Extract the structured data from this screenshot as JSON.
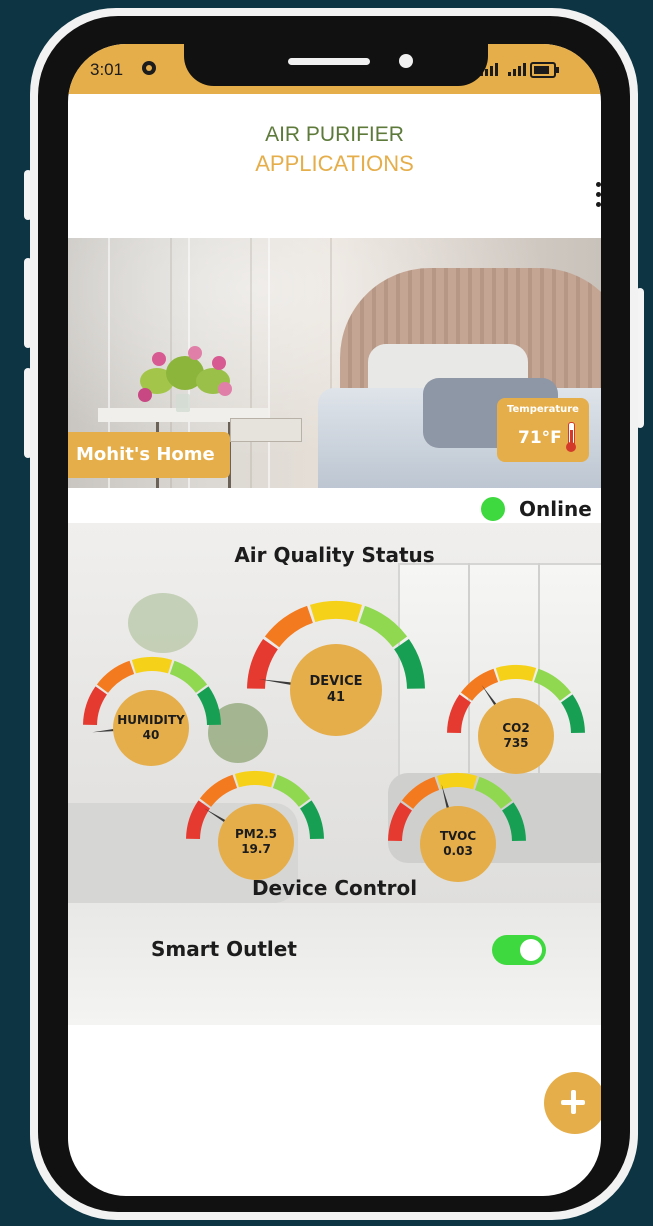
{
  "status_bar": {
    "time": "3:01"
  },
  "header": {
    "title_line1": "AIR PURIFIER",
    "title_line2": "APPLICATIONS"
  },
  "home": {
    "name": "Mohit's Home",
    "temperature_label": "Temperature",
    "temperature_value": "71°F"
  },
  "connection": {
    "status": "Online"
  },
  "air_quality": {
    "title": "Air Quality Status",
    "gauges": [
      {
        "id": "humidity",
        "label": "HUMIDITY",
        "value": "40"
      },
      {
        "id": "device",
        "label": "DEVICE",
        "value": "41"
      },
      {
        "id": "co2",
        "label": "CO2",
        "value": "735"
      },
      {
        "id": "pm25",
        "label": "PM2.5",
        "value": "19.7"
      },
      {
        "id": "tvoc",
        "label": "TVOC",
        "value": "0.03"
      }
    ]
  },
  "device_control": {
    "title": "Device Control",
    "smart_outlet": {
      "label": "Smart Outlet",
      "on": true
    }
  },
  "colors": {
    "accent": "#e5ae4a",
    "title_green": "#5d7a3b",
    "online": "#3ed93e",
    "gauge_segments": [
      "#e53a2f",
      "#f47a1f",
      "#f6d11a",
      "#8fd850",
      "#17a053"
    ]
  },
  "icons": {
    "call": "call-icon",
    "signal": "signal-icon",
    "battery": "battery-icon",
    "menu": "more-vert-icon",
    "thermometer": "thermometer-icon",
    "add": "plus-icon"
  }
}
